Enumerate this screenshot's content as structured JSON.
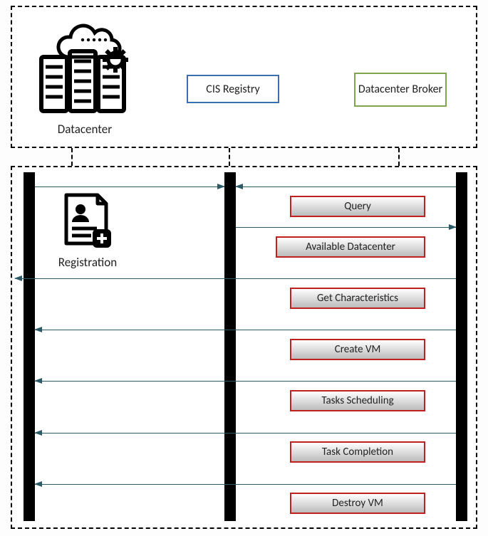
{
  "entities": {
    "datacenter_label": "Datacenter",
    "cis_label": "CIS Registry",
    "broker_label": "Datacenter Broker",
    "registration_label": "Registration"
  },
  "steps": {
    "query": "Query",
    "available": "Available Datacenter",
    "get_char": "Get Characteristics",
    "create_vm": "Create VM",
    "scheduling": "Tasks Scheduling",
    "completion": "Task Completion",
    "destroy": "Destroy VM"
  },
  "colors": {
    "cis_border": "#3a6fb0",
    "broker_border": "#7fa64f",
    "step_border": "#c02020",
    "arrow": "#2c5a66"
  }
}
